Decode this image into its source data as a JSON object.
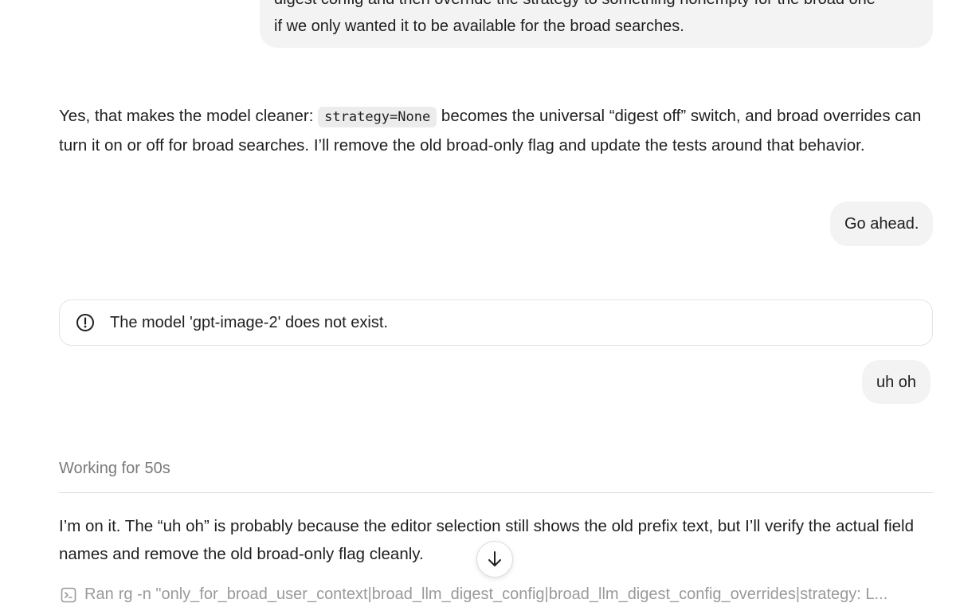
{
  "messages": {
    "user_1": {
      "line_1": "digest config and then override the strategy to something nonempty for the broad one",
      "line_2": "if we only wanted it to be available for the broad searches."
    },
    "assistant_1": {
      "before_code": "Yes, that makes the model cleaner: ",
      "code": "strategy=None",
      "after_code": " becomes the universal “digest off” switch, and broad overrides can turn it on or off for broad searches. I’ll remove the old broad-only flag and update the tests around that behavior."
    },
    "user_2": "Go ahead.",
    "error": {
      "icon": "alert-circle-icon",
      "text": "The model 'gpt-image-2' does not exist."
    },
    "user_3": "uh oh",
    "working_status": "Working for 50s",
    "assistant_2": "I’m on it. The “uh oh” is probably because the editor selection still shows the old prefix text, but I’ll verify the actual field names and remove the old broad-only flag cleanly.",
    "command": {
      "icon": "terminal-icon",
      "prefix": "Ran",
      "text": "rg -n \"only_for_broad_user_context|broad_llm_digest_config|broad_llm_digest_config_overrides|strategy: L..."
    }
  },
  "controls": {
    "scroll_down_icon": "arrow-down-icon"
  },
  "colors": {
    "bubble_bg": "#f3f3f3",
    "muted_text": "#7a7a7a",
    "code_bg": "#ececec",
    "border": "#e3e3e3"
  }
}
